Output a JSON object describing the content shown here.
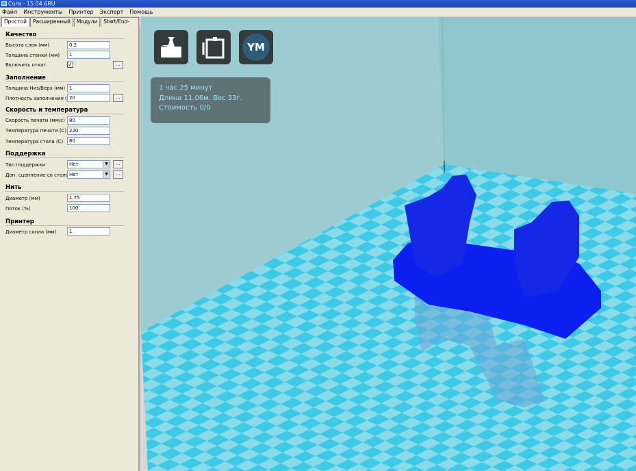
{
  "window": {
    "title": "Cura - 15.04.6RU"
  },
  "menu": [
    "Файл",
    "Инструменты",
    "Принтер",
    "Эксперт",
    "Помощь"
  ],
  "tabs": [
    "Простой",
    "Расширенный",
    "Модули",
    "Start/End-GCode"
  ],
  "sections": {
    "quality": {
      "title": "Качество",
      "layer_height_label": "Высота слоя (мм)",
      "layer_height": "0.2",
      "wall_label": "Толщина стенки (мм)",
      "wall": "1",
      "retract_label": "Включить откат",
      "retract_checked": "✓"
    },
    "fill": {
      "title": "Заполнение",
      "topbottom_label": "Толщина Низ/Верх (мм)",
      "topbottom": "1",
      "density_label": "Плотность заполнения (%)",
      "density": "20"
    },
    "speed": {
      "title": "Скорость и температура",
      "speed_label": "Скорость печати (мм/с)",
      "speed": "80",
      "temp_label": "Температура печати (C)",
      "temp": "220",
      "bed_label": "Температура стола (C)",
      "bed": "80"
    },
    "support": {
      "title": "Поддержка",
      "type_label": "Тип поддержки",
      "type": "Нет",
      "adhesion_label": "Доп. сцепление со столом",
      "adhesion": "Нет"
    },
    "filament": {
      "title": "Нить",
      "diameter_label": "Диаметр (мм)",
      "diameter": "1.75",
      "flow_label": "Поток (%)",
      "flow": "100"
    },
    "printer": {
      "title": "Принтер",
      "nozzle_label": "Диаметр сопла (мм)",
      "nozzle": "1"
    }
  },
  "more_label": "...",
  "arrow": "▼",
  "viewport": {
    "ym_label": "YM",
    "info": [
      "1 час 25 минут",
      "Длина 11.06м. Вес 33г.",
      "Стоимость 0/0"
    ]
  }
}
